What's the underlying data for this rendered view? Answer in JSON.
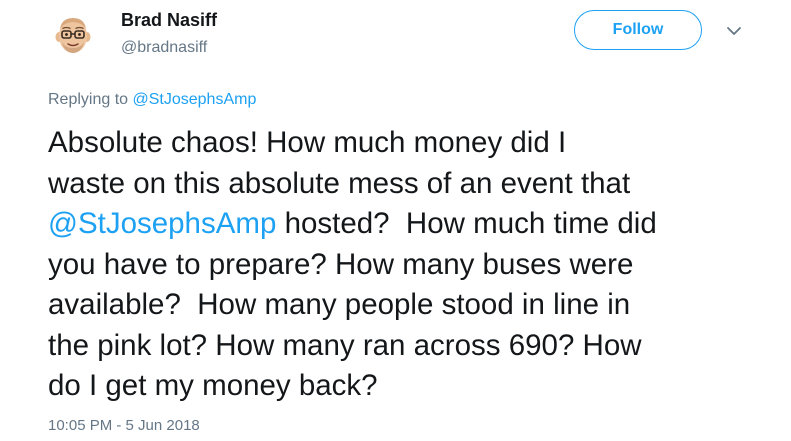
{
  "author": {
    "name": "Brad Nasiff",
    "handle": "@bradnasiff",
    "avatar_icon": "bitmoji-avatar"
  },
  "follow_button": {
    "label": "Follow"
  },
  "menu_icon": "chevron-down-icon",
  "reply_context": {
    "prefix": "Replying to",
    "mention": "@StJosephsAmp"
  },
  "tweet_text": {
    "lines": [
      "Absolute chaos! How much money did I",
      "waste on this absolute mess of an event that",
      "hosted?  How much time did",
      "you have to prepare? How many buses were",
      "available?  How many people stood in line in",
      "the pink lot? How many ran across 690? How",
      "do I get my money back?"
    ],
    "mention": "@StJosephsAmp"
  },
  "timestamp": "10:05 PM - 5 Jun 2018",
  "colors": {
    "accent": "#1da1f2",
    "text": "#14171a",
    "secondary_text": "#657786"
  }
}
